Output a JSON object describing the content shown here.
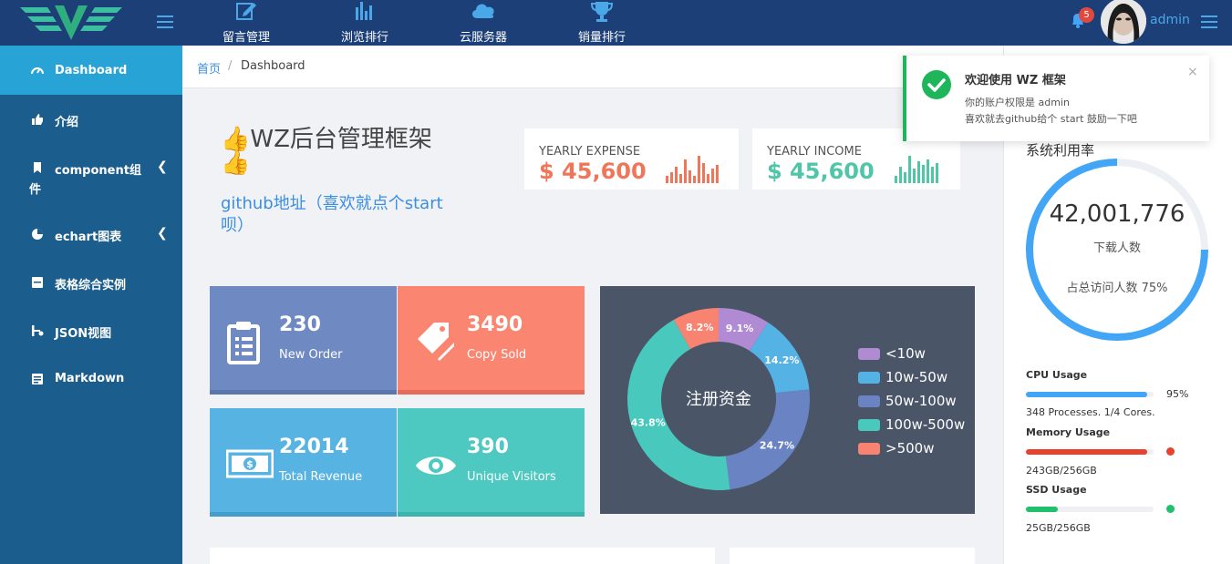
{
  "topnav": {
    "items": [
      {
        "label": "留言管理",
        "icon": "edit-icon"
      },
      {
        "label": "浏览排行",
        "icon": "bar-chart-icon"
      },
      {
        "label": "云服务器",
        "icon": "cloud-icon"
      },
      {
        "label": "销量排行",
        "icon": "trophy-icon"
      }
    ],
    "notification_count": "5",
    "username": "admin"
  },
  "sidebar": {
    "items": [
      {
        "label": "Dashboard",
        "icon": "dashboard-gauge-icon",
        "active": true
      },
      {
        "label": "介绍",
        "icon": "thumbs-up-icon"
      },
      {
        "label": "component组",
        "label2": "件",
        "icon": "bookmark-icon",
        "chevron": "❮"
      },
      {
        "label": "echart图表",
        "icon": "pie-chart-icon",
        "chevron": "❮"
      },
      {
        "label": "表格综合实例",
        "icon": "table-icon"
      },
      {
        "label": "JSON视图",
        "icon": "json-tree-icon"
      },
      {
        "label": "Markdown",
        "icon": "markdown-icon"
      }
    ]
  },
  "breadcrumb": {
    "home": "首页",
    "separator": "/",
    "current": "Dashboard"
  },
  "welcome": {
    "thumb_emoji": "👍",
    "title": "WZ后台管理框架",
    "link": "github地址（喜欢就点个start呗）"
  },
  "yearly": [
    {
      "label": "YEARLY EXPENSE",
      "value": "$ 45,600",
      "color": "#f0765a"
    },
    {
      "label": "YEARLY INCOME",
      "value": "$ 45,600",
      "color": "#4fc6a8"
    }
  ],
  "stats": [
    {
      "value": "230",
      "label": "New Order",
      "color": "#6f8ac2",
      "icon": "clipboard-icon"
    },
    {
      "value": "3490",
      "label": "Copy Sold",
      "color": "#fa8571",
      "icon": "tags-icon"
    },
    {
      "value": "22014",
      "label": "Total Revenue",
      "color": "#57b3e2",
      "icon": "money-icon"
    },
    {
      "value": "390",
      "label": "Unique Visitors",
      "color": "#4ec9c2",
      "icon": "eye-icon"
    }
  ],
  "chart_data": {
    "type": "pie",
    "title": "注册资金",
    "categories": [
      "<10w",
      "10w-50w",
      "50w-100w",
      "100w-500w",
      ">500w"
    ],
    "values": [
      9.1,
      14.2,
      24.7,
      43.8,
      8.2
    ],
    "labels": [
      "9.1%",
      "14.2%",
      "24.7%",
      "43.8%",
      "8.2%"
    ],
    "colors": [
      "#b18ad4",
      "#55b2e4",
      "#6a84c3",
      "#49c9bd",
      "#f88370"
    ],
    "legend": "right"
  },
  "right_panel": {
    "title": "系统利用率",
    "ring_value": "42,001,776",
    "ring_label": "下载人数",
    "ring_percent_text": "占总访问人数 75%",
    "ring_fraction": 0.75,
    "usage": [
      {
        "title": "CPU Usage",
        "percent": 95,
        "value": "95%",
        "detail": "348 Processes. 1/4 Cores.",
        "color": "#42a5f5"
      },
      {
        "title": "Memory Usage",
        "percent": 95,
        "detail": "243GB/256GB",
        "color": "#e8412d"
      },
      {
        "title": "SSD Usage",
        "percent": 25,
        "detail": "25GB/256GB",
        "color": "#22c06a"
      }
    ]
  },
  "toast": {
    "title": "欢迎使用 WZ 框架",
    "line1": "你的账户权限是 admin",
    "line2": "喜欢就去github给个 start 鼓励一下吧",
    "close": "×"
  }
}
